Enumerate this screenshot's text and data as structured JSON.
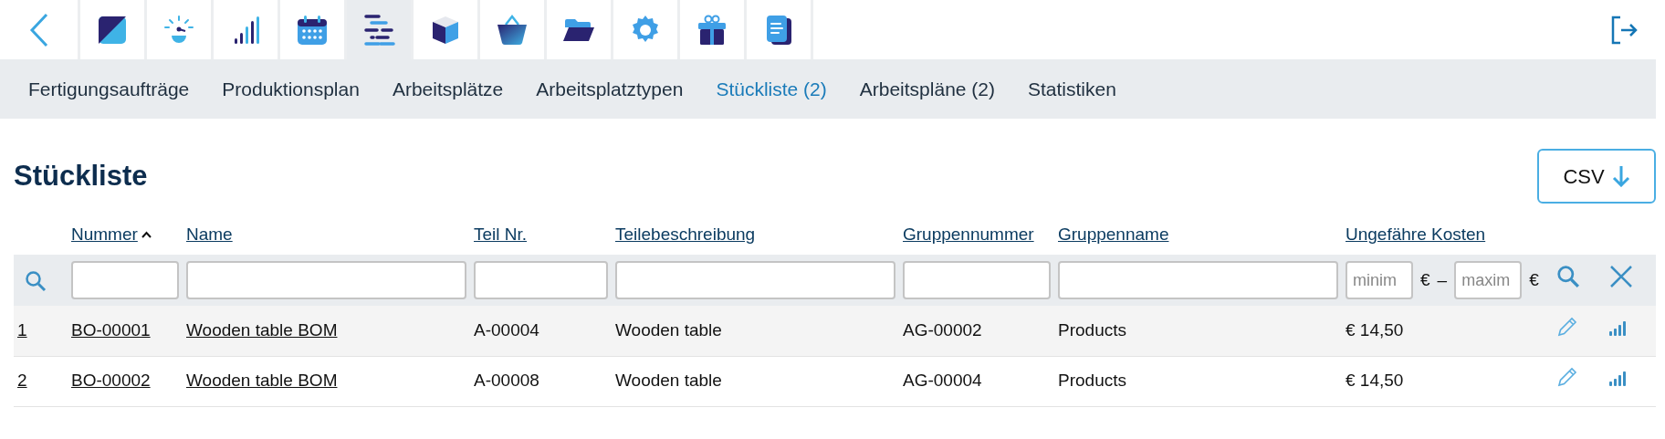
{
  "toolbar": {
    "tiles": [
      {
        "selected": false
      },
      {
        "selected": false
      },
      {
        "selected": false
      },
      {
        "selected": false
      },
      {
        "selected": true
      },
      {
        "selected": false
      },
      {
        "selected": false
      },
      {
        "selected": false
      },
      {
        "selected": false
      },
      {
        "selected": false
      },
      {
        "selected": false
      }
    ]
  },
  "subnav": [
    {
      "label": "Fertigungsaufträge",
      "selected": false
    },
    {
      "label": "Produktionsplan",
      "selected": false
    },
    {
      "label": "Arbeitsplätze",
      "selected": false
    },
    {
      "label": "Arbeitsplatztypen",
      "selected": false
    },
    {
      "label": "Stückliste (2)",
      "selected": true
    },
    {
      "label": "Arbeitspläne (2)",
      "selected": false
    },
    {
      "label": "Statistiken",
      "selected": false
    }
  ],
  "title": "Stückliste",
  "export_button": "CSV",
  "table": {
    "columns": [
      {
        "label": "Nummer",
        "sorted": true
      },
      {
        "label": "Name",
        "sorted": false
      },
      {
        "label": "Teil Nr.",
        "sorted": false
      },
      {
        "label": "Teilebeschreibung",
        "sorted": false
      },
      {
        "label": "Gruppennummer",
        "sorted": false
      },
      {
        "label": "Gruppenname",
        "sorted": false
      },
      {
        "label": "Ungefähre Kosten",
        "sorted": false
      }
    ],
    "cost_filter": {
      "min_placeholder": "minim",
      "min_unit": "€",
      "dash": "–",
      "max_placeholder": "maxim",
      "max_unit": "€"
    },
    "rows": [
      {
        "index": "1",
        "number": "BO-00001",
        "name": "Wooden table BOM",
        "part_no": "A-00004",
        "part_description": "Wooden table",
        "group_no": "AG-00002",
        "group_name": "Products",
        "cost": "€ 14,50"
      },
      {
        "index": "2",
        "number": "BO-00002",
        "name": "Wooden table BOM",
        "part_no": "A-00008",
        "part_description": "Wooden table",
        "group_no": "AG-00004",
        "group_name": "Products",
        "cost": "€ 14,50"
      }
    ]
  }
}
